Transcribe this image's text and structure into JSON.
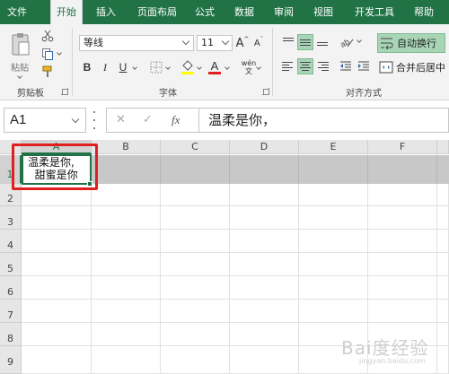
{
  "tabs": [
    "文件",
    "开始",
    "插入",
    "页面布局",
    "公式",
    "数据",
    "审阅",
    "视图",
    "开发工具",
    "帮助"
  ],
  "active_tab": "开始",
  "clipboard": {
    "paste_label": "粘贴",
    "group_label": "剪贴板"
  },
  "font": {
    "name": "等线",
    "size": "11",
    "group_label": "字体",
    "bold": "B",
    "italic": "I",
    "underline": "U",
    "grow": "A",
    "shrink": "A",
    "font_color": "A",
    "phonetic": "wén"
  },
  "alignment": {
    "wrap_text": "自动换行",
    "merge_center": "合并后居中",
    "group_label": "对齐方式"
  },
  "formula_bar": {
    "name_box": "A1",
    "cancel": "✕",
    "enter": "✓",
    "fx": "fx",
    "formula": "温柔是你，"
  },
  "columns": [
    "A",
    "B",
    "C",
    "D",
    "E",
    "F"
  ],
  "rows": [
    "1",
    "2",
    "3",
    "4",
    "5",
    "6",
    "7",
    "8",
    "9"
  ],
  "cell_a1": {
    "line1": "温柔是你,",
    "line2": "甜蜜是你"
  },
  "watermark": {
    "text": "Bai度经验",
    "sub": "jingyan.baidu.com"
  },
  "colors": {
    "accent": "#217346",
    "highlight": "#e02020"
  }
}
